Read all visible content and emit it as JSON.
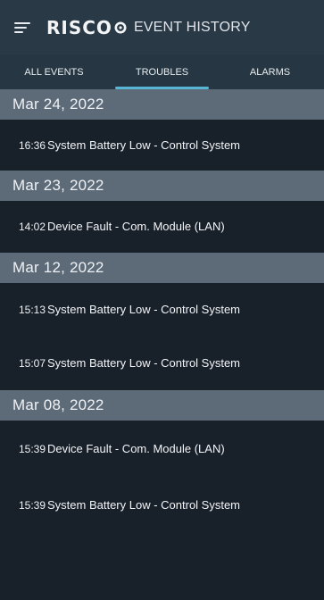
{
  "header": {
    "logo": "RISCO",
    "title": "EVENT HISTORY"
  },
  "tabs": [
    {
      "label": "ALL EVENTS",
      "active": false
    },
    {
      "label": "TROUBLES",
      "active": true
    },
    {
      "label": "ALARMS",
      "active": false
    }
  ],
  "groups": [
    {
      "date": "Mar 24, 2022",
      "events": [
        {
          "time": "16:36",
          "description": "System Battery Low - Control System"
        }
      ]
    },
    {
      "date": "Mar 23, 2022",
      "events": [
        {
          "time": "14:02",
          "description": "Device Fault - Com. Module (LAN)"
        }
      ]
    },
    {
      "date": "Mar 12, 2022",
      "events": [
        {
          "time": "15:13",
          "description": "System Battery Low - Control System"
        },
        {
          "time": "15:07",
          "description": "System Battery Low - Control System"
        }
      ]
    },
    {
      "date": "Mar 08, 2022",
      "events": [
        {
          "time": "15:39",
          "description": "Device Fault - Com. Module (LAN)"
        },
        {
          "time": "15:39",
          "description": "System Battery Low - Control System"
        }
      ]
    }
  ],
  "colors": {
    "background": "#18202a",
    "header": "#2a3946",
    "tabs": "#263642",
    "date_bar": "#5d6b79",
    "tab_indicator": "#58b6d4"
  }
}
